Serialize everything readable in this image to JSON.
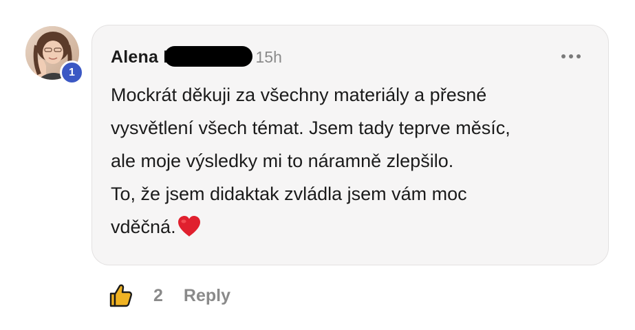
{
  "comment": {
    "author": {
      "name": "Alena K",
      "level_badge": "1"
    },
    "timestamp": "15h",
    "body_lines": [
      "Mockrát děkuji za všechny materiály a přesné",
      "vysvětlení všech témat. Jsem tady teprve měsíc,",
      "ale moje výsledky mi to náramně zlepšilo.",
      "To, že jsem didaktak zvládla jsem vám moc",
      "vděčná."
    ],
    "emoji": "heart-icon",
    "likes": "2",
    "reply_label": "Reply"
  },
  "colors": {
    "badge": "#3b58c4",
    "bubble_background": "#f6f5f5",
    "muted_text": "#8a8a8a",
    "heart": "#e0202e",
    "like_icon": "#f0b323"
  }
}
